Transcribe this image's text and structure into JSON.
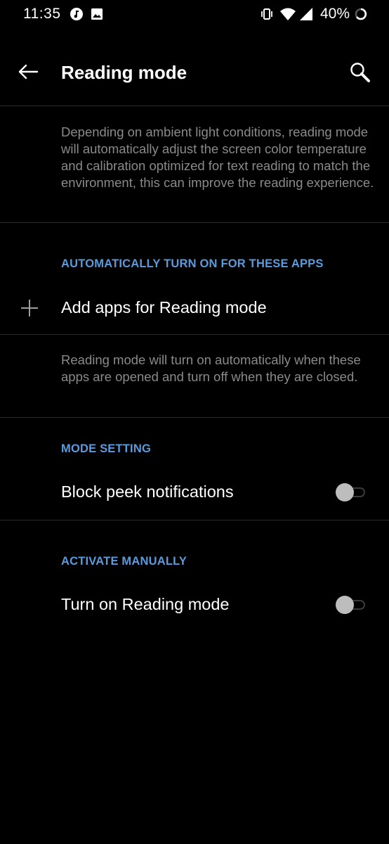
{
  "status_bar": {
    "time": "11:35",
    "battery_percent": "40%",
    "icons": [
      "music-app-icon",
      "image-icon",
      "vibrate-icon",
      "wifi-icon",
      "cell-signal-icon",
      "battery-charging-icon"
    ]
  },
  "app_bar": {
    "title": "Reading mode",
    "back_icon": "back-arrow-icon",
    "search_icon": "search-icon"
  },
  "intro": {
    "description": "Depending on ambient light conditions, reading mode will automatically adjust the screen color temperature and calibration optimized for text reading to match the environment, this can improve the reading experience."
  },
  "auto_apps": {
    "header": "AUTOMATICALLY TURN ON FOR THESE APPS",
    "add_label": "Add apps for Reading mode",
    "add_icon": "plus-icon",
    "description": "Reading mode will turn on automatically when these apps are opened and turn off when they are closed."
  },
  "mode_setting": {
    "header": "MODE SETTING",
    "block_peek_label": "Block peek notifications",
    "block_peek_enabled": false
  },
  "activate_manually": {
    "header": "ACTIVATE MANUALLY",
    "turn_on_label": "Turn on Reading mode",
    "turn_on_enabled": false
  },
  "colors": {
    "background": "#000000",
    "accent": "#5b9bdc",
    "secondary_text": "#8a8a8a",
    "divider": "#2a2a2a"
  }
}
